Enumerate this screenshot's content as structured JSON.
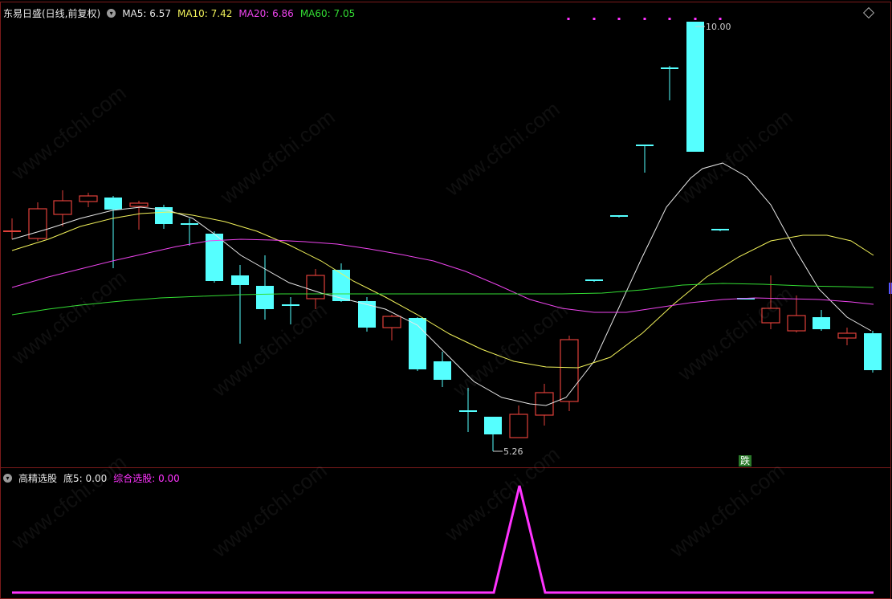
{
  "main": {
    "title": "东易日盛(日线,前复权)",
    "ma5": "MA5: 6.57",
    "ma10": "MA10: 7.42",
    "ma20": "MA20: 6.86",
    "ma60": "MA60: 7.05",
    "high_label": "10.00",
    "low_label": "5.26",
    "die_badge": "跌"
  },
  "sub": {
    "name": "高精选股",
    "di5": "底5: 0.00",
    "zonghe": "综合选股: 0.00"
  },
  "watermark": "www.cfchi.com",
  "colors": {
    "up": "#e0403a",
    "down": "#55ffff",
    "ma5": "#e8e8e8",
    "ma10": "#f2f25a",
    "ma20": "#ee44ee",
    "ma60": "#33dd33",
    "indicator": "#ff33ff"
  }
}
